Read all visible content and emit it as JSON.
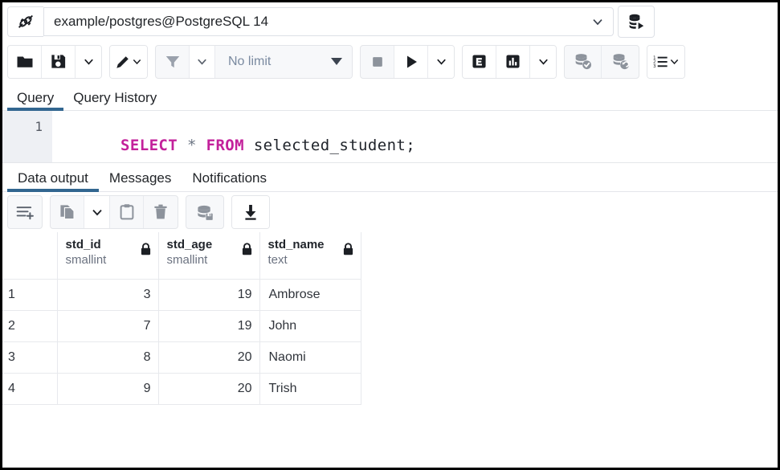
{
  "connection": {
    "plug_icon": "plug-connection-icon",
    "value": "example/postgres@PostgreSQL 14",
    "dropdown_icon": "chevron-down-icon",
    "db_connect_icon": "database-connect-icon"
  },
  "toolbar": {
    "open_file_label": "open-file",
    "save_file_label": "save-file",
    "save_dropdown_label": "save-options",
    "edit_label": "edit",
    "edit_dropdown_label": "edit-options",
    "filter_label": "filter",
    "filter_dropdown_label": "filter-options",
    "limit_value": "No limit",
    "stop_label": "stop",
    "execute_label": "execute",
    "execute_dropdown_label": "execute-options",
    "explain_label": "explain",
    "explain_analyze_label": "explain-analyze",
    "explain_dropdown_label": "explain-options",
    "commit_label": "commit",
    "rollback_label": "rollback",
    "macros_label": "macros"
  },
  "query_tabs": [
    {
      "label": "Query",
      "active": true
    },
    {
      "label": "Query History",
      "active": false
    }
  ],
  "editor": {
    "line_number": "1",
    "tokens": [
      {
        "text": "SELECT",
        "kind": "kw"
      },
      {
        "text": " ",
        "kind": "op"
      },
      {
        "text": "*",
        "kind": "op"
      },
      {
        "text": " ",
        "kind": "op"
      },
      {
        "text": "FROM",
        "kind": "kw"
      },
      {
        "text": " ",
        "kind": "op"
      },
      {
        "text": "selected_student;",
        "kind": "ident"
      }
    ],
    "full_text": "SELECT * FROM selected_student;"
  },
  "output_tabs": [
    {
      "label": "Data output",
      "active": true
    },
    {
      "label": "Messages",
      "active": false
    },
    {
      "label": "Notifications",
      "active": false
    }
  ],
  "output_toolbar": {
    "add_row_label": "add-row",
    "copy_label": "copy",
    "copy_dropdown_label": "copy-options",
    "paste_label": "paste",
    "delete_label": "delete-row",
    "save_data_label": "save-data-changes",
    "download_label": "download-csv"
  },
  "grid": {
    "rownum_header": "",
    "columns": [
      {
        "name": "std_id",
        "type": "smallint",
        "align": "num",
        "lock": true
      },
      {
        "name": "std_age",
        "type": "smallint",
        "align": "num",
        "lock": true
      },
      {
        "name": "std_name",
        "type": "text",
        "align": "txt",
        "lock": true
      }
    ],
    "rows": [
      {
        "num": "1",
        "cells": [
          "3",
          "19",
          "Ambrose"
        ]
      },
      {
        "num": "2",
        "cells": [
          "7",
          "19",
          "John"
        ]
      },
      {
        "num": "3",
        "cells": [
          "8",
          "20",
          "Naomi"
        ]
      },
      {
        "num": "4",
        "cells": [
          "9",
          "20",
          "Trish"
        ]
      }
    ]
  },
  "colors": {
    "accent_tab_underline": "#326690",
    "sql_keyword": "#c3219b",
    "sql_identifier": "#20242b",
    "limit_text": "#7a8aa0",
    "frame_border": "#000000"
  }
}
